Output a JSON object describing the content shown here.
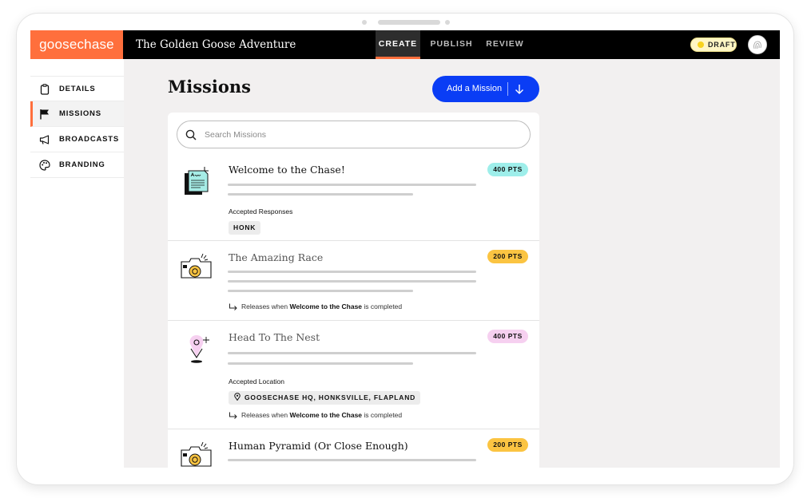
{
  "app": {
    "logo": "goosechase",
    "game_title": "The Golden Goose Adventure",
    "nav_tabs": [
      {
        "label": "CREATE",
        "active": true
      },
      {
        "label": "PUBLISH",
        "active": false
      },
      {
        "label": "REVIEW",
        "active": false
      }
    ],
    "status_badge": "DRAFT",
    "accent_color": "#ff6f3c"
  },
  "sidebar": {
    "items": [
      {
        "label": "DETAILS",
        "icon": "clipboard-icon",
        "active": false
      },
      {
        "label": "MISSIONS",
        "icon": "flag-icon",
        "active": true
      },
      {
        "label": "BROADCASTS",
        "icon": "megaphone-icon",
        "active": false
      },
      {
        "label": "BRANDING",
        "icon": "palette-icon",
        "active": false
      }
    ]
  },
  "main": {
    "title": "Missions",
    "add_button": "Add a Mission",
    "search_placeholder": "Search Missions",
    "missions": [
      {
        "title": "Welcome to the Chase!",
        "points": "400 PTS",
        "points_color": "#9eeeea",
        "icon": "document-icon",
        "accepted_label": "Accepted Responses",
        "accepted_value": "HONK"
      },
      {
        "title": "The Amazing Race",
        "points": "200 PTS",
        "points_color": "#fbc442",
        "icon": "camera-icon",
        "release_prefix": "Releases when",
        "release_mission": "Welcome to the Chase",
        "release_suffix": "is completed"
      },
      {
        "title": "Head To The Nest",
        "points": "400 PTS",
        "points_color": "#f6d0f0",
        "icon": "location-pin-icon",
        "accepted_label": "Accepted Location",
        "accepted_value": "GOOSECHASE HQ, HONKSVILLE, FLAPLAND",
        "release_prefix": "Releases when",
        "release_mission": "Welcome to the Chase",
        "release_suffix": "is completed"
      },
      {
        "title": "Human Pyramid (Or Close Enough)",
        "points": "200 PTS",
        "points_color": "#fbc442",
        "icon": "camera-icon"
      }
    ]
  }
}
